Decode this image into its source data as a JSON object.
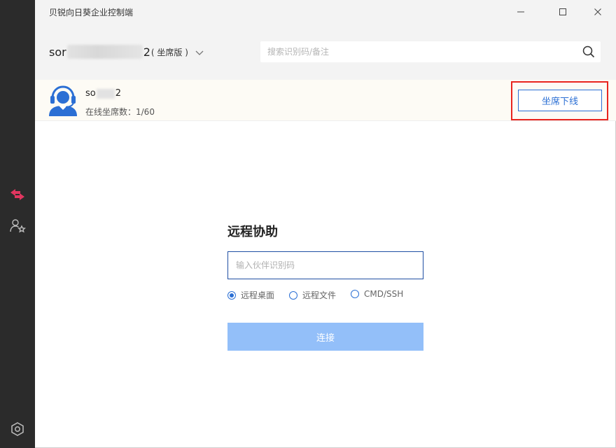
{
  "app": {
    "title": "贝锐向日葵企业控制端"
  },
  "window_controls": {
    "minimize": "minimize-icon",
    "maximize": "maximize-icon",
    "close": "close-icon"
  },
  "sidebar": {
    "items": [
      {
        "icon": "remote-control-icon",
        "active": true,
        "color": "#e0365f"
      },
      {
        "icon": "user-star-icon",
        "active": false
      }
    ],
    "bottom_icon": "settings-hexagon-icon"
  },
  "header": {
    "account_prefix": "sor",
    "account_suffix": "2",
    "edition": "( 坐席版 )",
    "search_placeholder": "搜索识别码/备注"
  },
  "agent": {
    "name_prefix": "so",
    "name_suffix": "2",
    "status": "在线坐席数：1/60",
    "offline_button": "坐席下线"
  },
  "remote": {
    "title": "远程协助",
    "input_placeholder": "输入伙伴识别码",
    "options": [
      {
        "label": "远程桌面",
        "checked": true
      },
      {
        "label": "远程文件",
        "checked": false
      },
      {
        "label": "CMD/SSH",
        "checked": false
      }
    ],
    "connect_button": "连接"
  },
  "colors": {
    "accent": "#2b6fd4",
    "highlight": "#e8251f",
    "connect_disabled": "#93bff9",
    "sidebar_bg": "#2b2b2b"
  }
}
